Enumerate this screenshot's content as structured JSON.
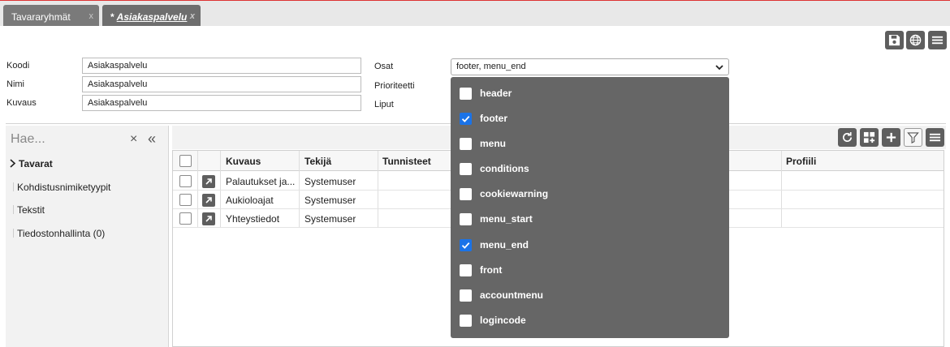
{
  "tabs": [
    {
      "label": "Tavararyhmät",
      "close": "x",
      "active": false
    },
    {
      "label": "Asiakaspalvelu",
      "modified": "*",
      "close": "x",
      "active": true
    }
  ],
  "toolbar_icons": [
    "save-icon",
    "globe-icon",
    "menu-icon"
  ],
  "form": {
    "koodi_label": "Koodi",
    "koodi_value": "Asiakaspalvelu",
    "nimi_label": "Nimi",
    "nimi_value": "Asiakaspalvelu",
    "kuvaus_label": "Kuvaus",
    "kuvaus_value": "Asiakaspalvelu",
    "osat_label": "Osat",
    "osat_value": "footer, menu_end",
    "prioriteetti_label": "Prioriteetti",
    "liput_label": "Liput"
  },
  "osat_options": [
    {
      "label": "header",
      "checked": false
    },
    {
      "label": "footer",
      "checked": true
    },
    {
      "label": "menu",
      "checked": false
    },
    {
      "label": "conditions",
      "checked": false
    },
    {
      "label": "cookiewarning",
      "checked": false
    },
    {
      "label": "menu_start",
      "checked": false
    },
    {
      "label": "menu_end",
      "checked": true
    },
    {
      "label": "front",
      "checked": false
    },
    {
      "label": "accountmenu",
      "checked": false
    },
    {
      "label": "logincode",
      "checked": false
    }
  ],
  "left_panel": {
    "search_placeholder": "Hae...",
    "clear": "×",
    "collapse": "«",
    "tree": [
      {
        "label": "Tavarat",
        "bold": true
      },
      {
        "label": "Kohdistusnimiketyypit"
      },
      {
        "label": "Tekstit"
      },
      {
        "label": "Tiedostonhallinta (0)"
      }
    ]
  },
  "grid": {
    "columns": [
      "Kuvaus",
      "Tekijä",
      "Tunnisteet",
      "Profiili"
    ],
    "rows": [
      {
        "kuvaus": "Palautukset ja...",
        "tekija": "Systemuser"
      },
      {
        "kuvaus": "Aukioloajat",
        "tekija": "Systemuser"
      },
      {
        "kuvaus": "Yhteystiedot",
        "tekija": "Systemuser"
      }
    ],
    "toolbar_icons": [
      "refresh-icon",
      "add-widget-icon",
      "plus-icon",
      "filter-icon",
      "menu-icon"
    ]
  }
}
